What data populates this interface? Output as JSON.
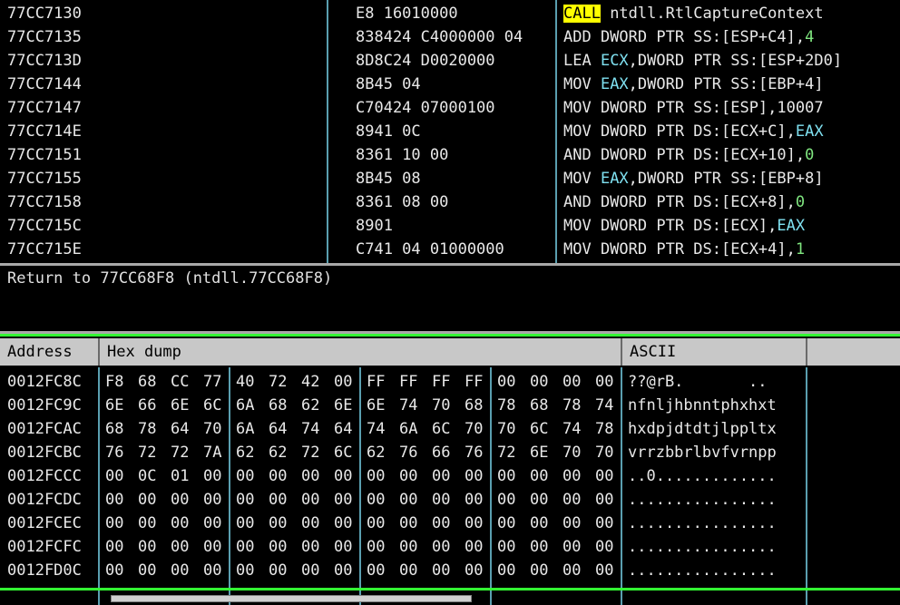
{
  "disasm": {
    "rows": [
      {
        "addr": "77CC7130",
        "hex": "E8 16010000",
        "asm": [
          {
            "t": "CALL",
            "c": "call"
          },
          {
            "t": " ntdll.RtlCaptureContext"
          }
        ]
      },
      {
        "addr": "77CC7135",
        "hex": "838424 C4000000 04",
        "asm": [
          {
            "t": "ADD DWORD PTR SS:[ESP+C4],"
          },
          {
            "t": "4",
            "c": "num"
          }
        ]
      },
      {
        "addr": "77CC713D",
        "hex": "8D8C24 D0020000",
        "asm": [
          {
            "t": "LEA "
          },
          {
            "t": "ECX",
            "c": "reg"
          },
          {
            "t": ",DWORD PTR SS:[ESP+2D0]"
          }
        ]
      },
      {
        "addr": "77CC7144",
        "hex": "8B45 04",
        "asm": [
          {
            "t": "MOV "
          },
          {
            "t": "EAX",
            "c": "reg"
          },
          {
            "t": ",DWORD PTR SS:[EBP+4]"
          }
        ]
      },
      {
        "addr": "77CC7147",
        "hex": "C70424 07000100",
        "asm": [
          {
            "t": "MOV DWORD PTR SS:[ESP],10007"
          }
        ]
      },
      {
        "addr": "77CC714E",
        "hex": "8941 0C",
        "asm": [
          {
            "t": "MOV DWORD PTR DS:[ECX+C],"
          },
          {
            "t": "EAX",
            "c": "reg"
          }
        ]
      },
      {
        "addr": "77CC7151",
        "hex": "8361 10 00",
        "asm": [
          {
            "t": "AND DWORD PTR DS:[ECX+10],"
          },
          {
            "t": "0",
            "c": "num"
          }
        ]
      },
      {
        "addr": "77CC7155",
        "hex": "8B45 08",
        "asm": [
          {
            "t": "MOV "
          },
          {
            "t": "EAX",
            "c": "reg"
          },
          {
            "t": ",DWORD PTR SS:[EBP+8]"
          }
        ]
      },
      {
        "addr": "77CC7158",
        "hex": "8361 08 00",
        "asm": [
          {
            "t": "AND DWORD PTR DS:[ECX+8],"
          },
          {
            "t": "0",
            "c": "num"
          }
        ]
      },
      {
        "addr": "77CC715C",
        "hex": "8901",
        "asm": [
          {
            "t": "MOV DWORD PTR DS:[ECX],"
          },
          {
            "t": "EAX",
            "c": "reg"
          }
        ]
      },
      {
        "addr": "77CC715E",
        "hex": "C741 04 01000000",
        "asm": [
          {
            "t": "MOV DWORD PTR DS:[ECX+4],"
          },
          {
            "t": "1",
            "c": "num"
          }
        ]
      }
    ]
  },
  "info": {
    "text": "Return to 77CC68F8 (ntdll.77CC68F8)"
  },
  "dump": {
    "headers": {
      "address": "Address",
      "hex": "Hex dump",
      "ascii": "ASCII"
    },
    "rows": [
      {
        "addr": "0012FC8C",
        "bytes": [
          "F8",
          "68",
          "CC",
          "77",
          "40",
          "72",
          "42",
          "00",
          "FF",
          "FF",
          "FF",
          "FF",
          "00",
          "00",
          "00",
          "00"
        ],
        "ascii": "??@rB.       .."
      },
      {
        "addr": "0012FC9C",
        "bytes": [
          "6E",
          "66",
          "6E",
          "6C",
          "6A",
          "68",
          "62",
          "6E",
          "6E",
          "74",
          "70",
          "68",
          "78",
          "68",
          "78",
          "74"
        ],
        "ascii": "nfnljhbnntphxhxt"
      },
      {
        "addr": "0012FCAC",
        "bytes": [
          "68",
          "78",
          "64",
          "70",
          "6A",
          "64",
          "74",
          "64",
          "74",
          "6A",
          "6C",
          "70",
          "70",
          "6C",
          "74",
          "78"
        ],
        "ascii": "hxdpjdtdtjlppltx"
      },
      {
        "addr": "0012FCBC",
        "bytes": [
          "76",
          "72",
          "72",
          "7A",
          "62",
          "62",
          "72",
          "6C",
          "62",
          "76",
          "66",
          "76",
          "72",
          "6E",
          "70",
          "70"
        ],
        "ascii": "vrrzbbrlbvfvrnpp"
      },
      {
        "addr": "0012FCCC",
        "bytes": [
          "00",
          "0C",
          "01",
          "00",
          "00",
          "00",
          "00",
          "00",
          "00",
          "00",
          "00",
          "00",
          "00",
          "00",
          "00",
          "00"
        ],
        "ascii": "..0............."
      },
      {
        "addr": "0012FCDC",
        "bytes": [
          "00",
          "00",
          "00",
          "00",
          "00",
          "00",
          "00",
          "00",
          "00",
          "00",
          "00",
          "00",
          "00",
          "00",
          "00",
          "00"
        ],
        "ascii": "................"
      },
      {
        "addr": "0012FCEC",
        "bytes": [
          "00",
          "00",
          "00",
          "00",
          "00",
          "00",
          "00",
          "00",
          "00",
          "00",
          "00",
          "00",
          "00",
          "00",
          "00",
          "00"
        ],
        "ascii": "................"
      },
      {
        "addr": "0012FCFC",
        "bytes": [
          "00",
          "00",
          "00",
          "00",
          "00",
          "00",
          "00",
          "00",
          "00",
          "00",
          "00",
          "00",
          "00",
          "00",
          "00",
          "00"
        ],
        "ascii": "................"
      },
      {
        "addr": "0012FD0C",
        "bytes": [
          "00",
          "00",
          "00",
          "00",
          "00",
          "00",
          "00",
          "00",
          "00",
          "00",
          "00",
          "00",
          "00",
          "00",
          "00",
          "00"
        ],
        "ascii": "................"
      }
    ]
  },
  "colors": {
    "register": "#7fe0f0",
    "immediate": "#7fe57f",
    "call_highlight": "#ffff00",
    "pane_border": "#33ff33"
  }
}
